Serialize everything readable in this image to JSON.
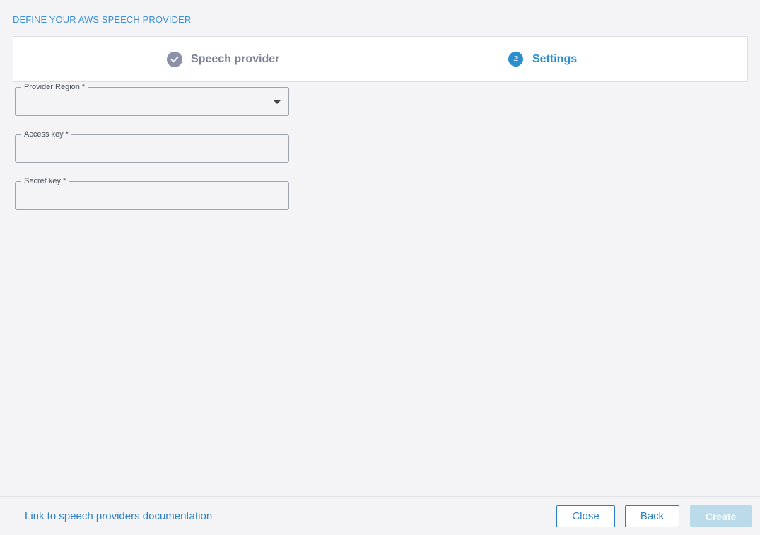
{
  "dialog": {
    "title": "DEFINE YOUR AWS SPEECH PROVIDER"
  },
  "stepper": {
    "steps": [
      {
        "label": "Speech provider",
        "state": "completed",
        "icon": "check-circle-icon"
      },
      {
        "label": "Settings",
        "state": "active",
        "number": "2"
      }
    ]
  },
  "form": {
    "provider_region": {
      "label": "Provider Region *",
      "value": "",
      "type": "select"
    },
    "access_key": {
      "label": "Access key *",
      "value": ""
    },
    "secret_key": {
      "label": "Secret key *",
      "value": ""
    }
  },
  "footer": {
    "doc_link": "Link to speech providers documentation",
    "close_label": "Close",
    "back_label": "Back",
    "create_label": "Create"
  },
  "colors": {
    "accent": "#2b8fcf",
    "completed_step": "#8a91a8",
    "create_disabled": "#bcdbea",
    "background": "#f4f4f6"
  }
}
